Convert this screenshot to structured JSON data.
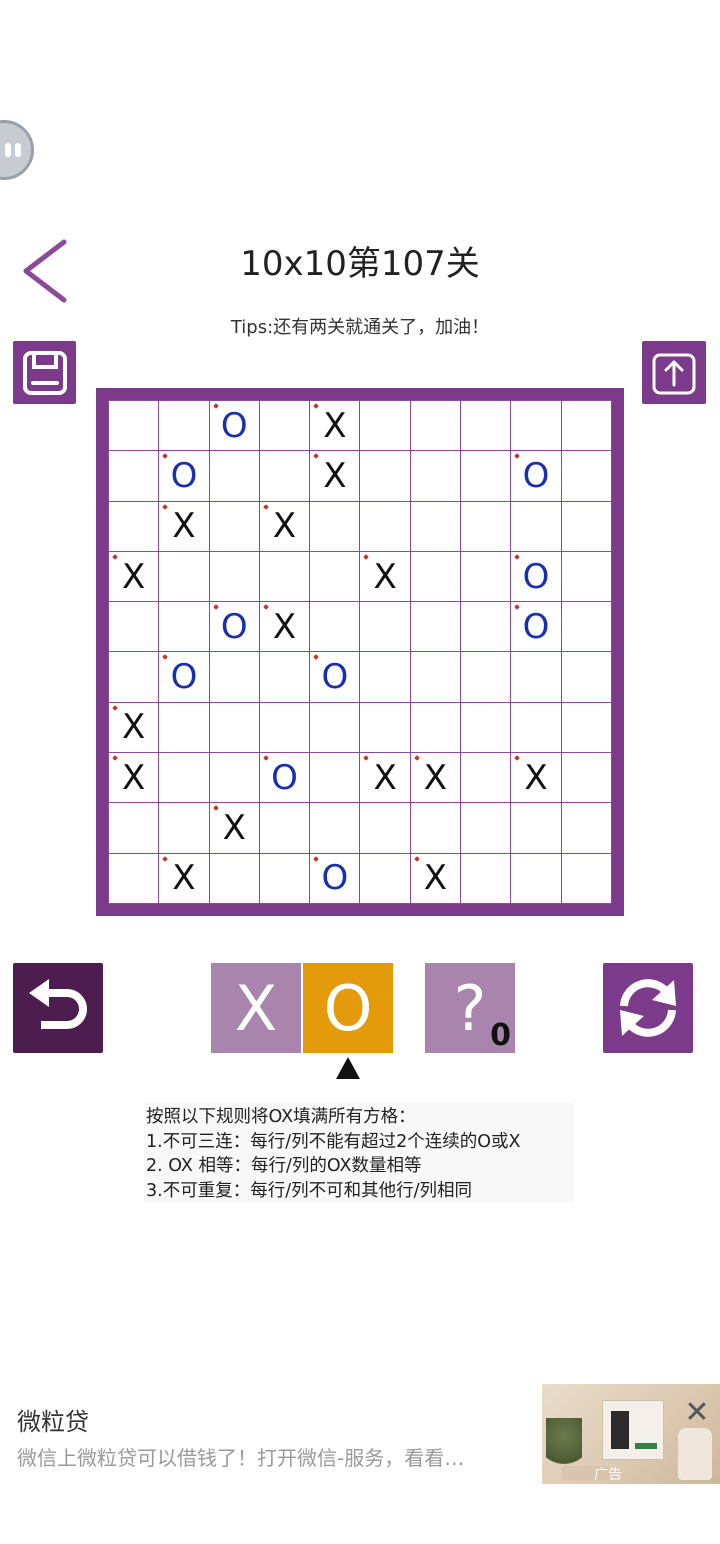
{
  "header": {
    "title": "10x10第107关",
    "tips": "Tips:还有两关就通关了，加油！",
    "back_icon": "chevron-left-icon",
    "save_icon": "floppy-disk-icon",
    "share_icon": "upload-icon"
  },
  "board": {
    "rows": [
      [
        "",
        "",
        "O*",
        "",
        "X*",
        "",
        "",
        "",
        "",
        ""
      ],
      [
        "",
        "O*",
        "",
        "",
        "X*",
        "",
        "",
        "",
        "O*",
        ""
      ],
      [
        "",
        "X*",
        "",
        "X*",
        "",
        "",
        "",
        "",
        "",
        ""
      ],
      [
        "X*",
        "",
        "",
        "",
        "",
        "X*",
        "",
        "",
        "O*",
        ""
      ],
      [
        "",
        "",
        "O*",
        "X*",
        "",
        "",
        "",
        "",
        "O*",
        ""
      ],
      [
        "",
        "O*",
        "",
        "",
        "O*",
        "",
        "",
        "",
        "",
        ""
      ],
      [
        "X*",
        "",
        "",
        "",
        "",
        "",
        "",
        "",
        "",
        ""
      ],
      [
        "X*",
        "",
        "",
        "O*",
        "",
        "X*",
        "X*",
        "",
        "X*",
        ""
      ],
      [
        "",
        "",
        "X*",
        "",
        "",
        "",
        "",
        "",
        "",
        ""
      ],
      [
        "",
        "X*",
        "",
        "",
        "O*",
        "",
        "X*",
        "",
        "",
        ""
      ]
    ],
    "colors": {
      "frame": "#7c3a8a",
      "x": "#111111",
      "o": "#1a2fb0"
    }
  },
  "controls": {
    "undo_icon": "undo-arrow-icon",
    "refresh_icon": "refresh-icon",
    "mode_x_label": "X",
    "mode_o_label": "O",
    "hint_label": "?",
    "hint_count": "0",
    "selected_mode": "O"
  },
  "rules": {
    "lines": [
      "按照以下规则将OX填满所有方格：",
      "1.不可三连：每行/列不能有超过2个连续的O或X",
      "2. OX 相等：每行/列的OX数量相等",
      "3.不可重复：每行/列不可和其他行/列相同"
    ]
  },
  "ad": {
    "title": "微粒贷",
    "description": "微信上微粒贷可以借钱了！打开微信-服务，看看…",
    "label": "广告",
    "close_icon": "close-icon"
  }
}
